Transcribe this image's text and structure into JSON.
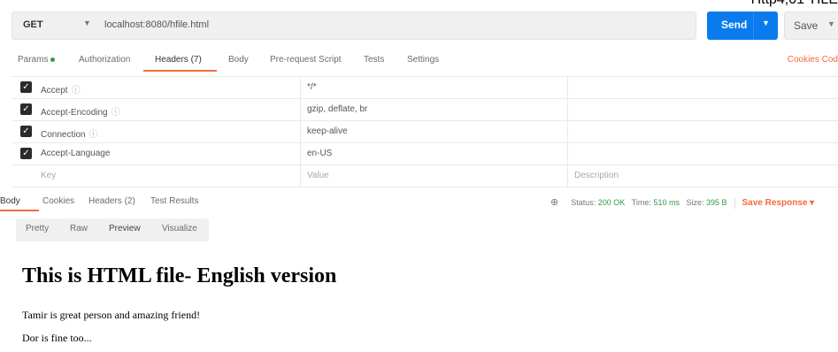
{
  "top_label": "Http4,01 TILE",
  "request": {
    "method": "GET",
    "url": "localhost:8080/hfile.html",
    "send_label": "Send",
    "save_label": "Save"
  },
  "request_tabs": [
    {
      "label": "Params"
    },
    {
      "label": "Authorization"
    },
    {
      "label": "Headers (7)"
    },
    {
      "label": "Body"
    },
    {
      "label": "Pre-request Script"
    },
    {
      "label": "Tests"
    },
    {
      "label": "Settings"
    }
  ],
  "request_tabs_right": "Cookies  Cod",
  "headers": [
    {
      "key": "Accept",
      "value": "*/*"
    },
    {
      "key": "Accept-Encoding",
      "value": "gzip, deflate, br"
    },
    {
      "key": "Connection",
      "value": "keep-alive"
    },
    {
      "key": "Accept-Language",
      "value": "en-US"
    }
  ],
  "headers_placeholder": {
    "key": "Key",
    "value": "Value",
    "description": "Description"
  },
  "response_tabs": [
    {
      "label": "Body"
    },
    {
      "label": "Cookies"
    },
    {
      "label": "Headers (2)"
    },
    {
      "label": "Test Results"
    }
  ],
  "status": {
    "status": "200 OK",
    "time": "510 ms",
    "size": "395 B",
    "save_response": "Save Response"
  },
  "view_tabs": [
    "Pretty",
    "Raw",
    "Preview",
    "Visualize"
  ],
  "preview": {
    "heading": "This is HTML file- English version",
    "p1": "Tamir is great person and amazing friend!",
    "p2": "Dor is fine too..."
  },
  "colors": {
    "accent": "#f26b3a",
    "send": "#097bed",
    "status_ok": "#2e9b48"
  }
}
